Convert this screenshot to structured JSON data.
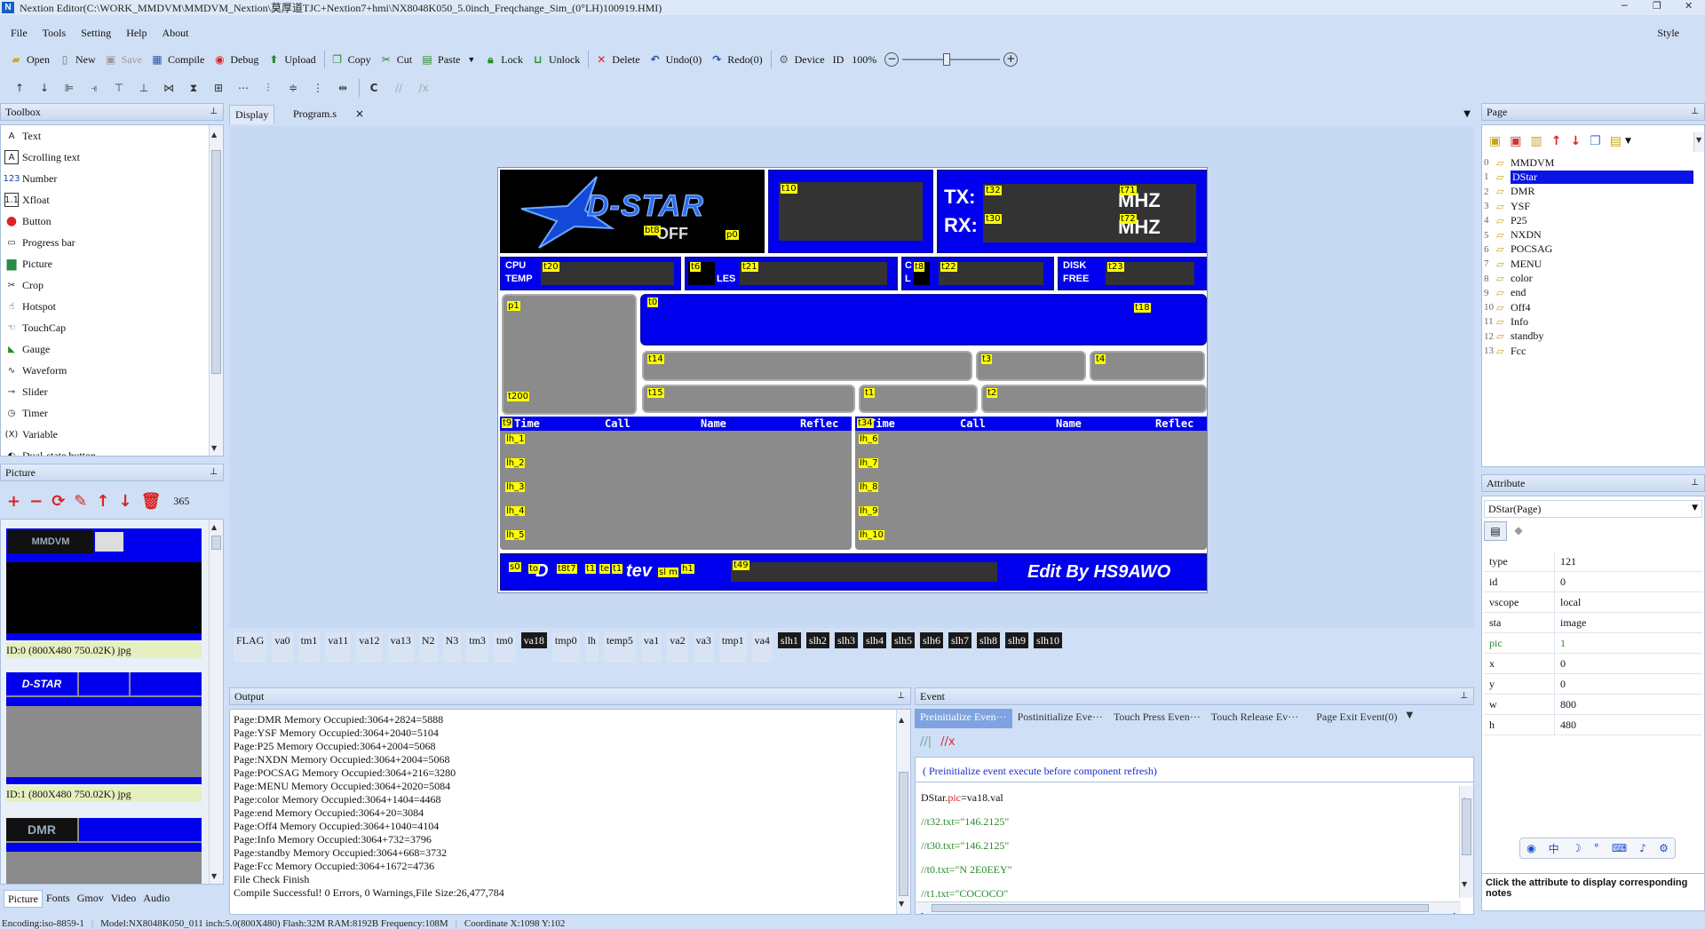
{
  "window": {
    "title": "Nextion  Editor(C:\\WORK_MMDVM\\MMDVM_Nextion\\莫厚道TJC+Nextion7+hmi\\NX8048K050_5.0inch_Freqchange_Sim_(0°LH)100919.HMI)",
    "controls": [
      "─",
      "❐",
      "✕"
    ]
  },
  "menu": {
    "items": [
      "File",
      "Tools",
      "Setting",
      "Help",
      "About"
    ],
    "style": "Style"
  },
  "toolbar": {
    "open": "Open",
    "new": "New",
    "save": "Save",
    "compile": "Compile",
    "debug": "Debug",
    "upload": "Upload",
    "copy": "Copy",
    "cut": "Cut",
    "paste": "Paste",
    "lock": "Lock",
    "unlock": "Unlock",
    "delete": "Delete",
    "undo": "Undo(0)",
    "redo": "Redo(0)",
    "device": "Device",
    "id": "ID",
    "zoom": "100%"
  },
  "toolbox": {
    "title": "Toolbox",
    "items": [
      "Text",
      "Scrolling text",
      "Number",
      "Xfloat",
      "Button",
      "Progress bar",
      "Picture",
      "Crop",
      "Hotspot",
      "TouchCap",
      "Gauge",
      "Waveform",
      "Slider",
      "Timer",
      "Variable",
      "Dual-state button"
    ]
  },
  "picture_panel": {
    "title": "Picture",
    "count": "365",
    "captions": [
      "ID:0  (800X480 750.02K) jpg",
      "ID:1  (800X480 750.02K) jpg"
    ],
    "tabs": [
      "Picture",
      "Fonts",
      "Gmov",
      "Video",
      "Audio"
    ]
  },
  "doc_tabs": {
    "display": "Display",
    "program": "Program.s",
    "close": "×"
  },
  "hmi": {
    "labels": {
      "t10": "t10",
      "t32": "t32",
      "t30": "t30",
      "t71": "t71",
      "t72": "t72",
      "bt8": "bt8",
      "p0": "p0",
      "t20": "t20",
      "t6": "t6",
      "t21": "t21",
      "t8": "t8",
      "t22": "t22",
      "t23": "t23",
      "p1": "p1",
      "t0": "t0",
      "t18": "t18",
      "t200": "t200",
      "t14": "t14",
      "t3": "t3",
      "t4": "t4",
      "t15": "t15",
      "t1": "t1",
      "t2": "t2",
      "t9": "t9",
      "t34": "t34",
      "lh1": "lh_1",
      "lh2": "lh_2",
      "lh3": "lh_3",
      "lh4": "lh_4",
      "lh5": "lh_5",
      "lh6": "lh_6",
      "lh7": "lh_7",
      "lh8": "lh_8",
      "lh9": "lh_9",
      "lh10": "lh_10",
      "s0": "s0",
      "t49": "t49",
      "fstack": "to",
      "t7": "t8t7",
      "t11": "t1",
      "tc": "te",
      "tt1": "t1",
      "slm": "sl m",
      "h1": "h1"
    },
    "dstar": "D-STAR",
    "off": "OFF",
    "tx": "TX:",
    "rx": "RX:",
    "mhz": "MHZ",
    "cpu": "CPU",
    "temp": "TEMP",
    "les": "LES",
    "c": "C",
    "l": "L",
    "disk": "DISK",
    "free": "FREE",
    "cols": [
      "Time",
      "Call",
      "Name",
      "Reflec"
    ],
    "cols2": [
      "Time",
      "Call",
      "Name",
      "Reflec"
    ],
    "footer_left": "D",
    "footer_mid": "tev",
    "edit_by": "Edit By HS9AWO"
  },
  "variables": [
    "FLAG",
    "va0",
    "tm1",
    "va11",
    "va12",
    "va13",
    "N2",
    "N3",
    "tm3",
    "tm0",
    "va18",
    "tmp0",
    "lh",
    "temp5",
    "va1",
    "va2",
    "va3",
    "tmp1",
    "va4",
    "slh1",
    "slh2",
    "slh3",
    "slh4",
    "slh5",
    "slh6",
    "slh7",
    "slh8",
    "slh9",
    "slh10"
  ],
  "variables_dark": [
    "va18",
    "slh1",
    "slh2",
    "slh3",
    "slh4",
    "slh5",
    "slh6",
    "slh7",
    "slh8",
    "slh9",
    "slh10"
  ],
  "output": {
    "title": "Output",
    "lines": [
      "Page:DMR Memory Occupied:3064+2824=5888",
      "Page:YSF Memory Occupied:3064+2040=5104",
      "Page:P25 Memory Occupied:3064+2004=5068",
      "Page:NXDN Memory Occupied:3064+2004=5068",
      "Page:POCSAG Memory Occupied:3064+216=3280",
      "Page:MENU Memory Occupied:3064+2020=5084",
      "Page:color Memory Occupied:3064+1404=4468",
      "Page:end Memory Occupied:3064+20=3084",
      "Page:Off4 Memory Occupied:3064+1040=4104",
      "Page:Info Memory Occupied:3064+732=3796",
      "Page:standby Memory Occupied:3064+668=3732",
      "Page:Fcc Memory Occupied:3064+1672=4736",
      "File Check Finish",
      "Compile Successful! 0 Errors, 0 Warnings,File Size:26,477,784"
    ]
  },
  "event": {
    "title": "Event",
    "tabs": [
      "Preinitialize  Even···",
      "Postinitialize  Eve···",
      "Touch Press Even···",
      "Touch Release  Ev···",
      "Page Exit Event(0)"
    ],
    "hint": "( Preinitialize event execute before component refresh)",
    "code": [
      "DStar.pic=va18.val",
      "//t32.txt=\"146.2125\"",
      "//t30.txt=\"146.2125\"",
      "//t0.txt=\"N 2E0EEY\"",
      "//t1.txt=\"COCOCO\""
    ],
    "code_kw": "pic"
  },
  "page_panel": {
    "title": "Page",
    "pages": [
      "MMDVM",
      "DStar",
      "DMR",
      "YSF",
      "P25",
      "NXDN",
      "POCSAG",
      "MENU",
      "color",
      "end",
      "Off4",
      "Info",
      "standby",
      "Fcc"
    ],
    "selected": 1
  },
  "attribute": {
    "title": "Attribute",
    "object": "DStar(Page)",
    "rows": [
      [
        "type",
        "121"
      ],
      [
        "id",
        "0"
      ],
      [
        "vscope",
        "local"
      ],
      [
        "sta",
        "image"
      ],
      [
        "pic",
        "1"
      ],
      [
        "x",
        "0"
      ],
      [
        "y",
        "0"
      ],
      [
        "w",
        "800"
      ],
      [
        "h",
        "480"
      ]
    ],
    "note": "Click the attribute to display corresponding notes"
  },
  "status": {
    "encoding": "Encoding:iso-8859-1",
    "model": "Model:NX8048K050_011   inch:5.0(800X480) Flash:32M  RAM:8192B  Frequency:108M",
    "coord": "Coordinate X:1098  Y:102"
  },
  "colors": {
    "accent": "#0000ee",
    "label": "#ffff00",
    "panel": "#cfdff5",
    "selected": "#0a14e6"
  }
}
